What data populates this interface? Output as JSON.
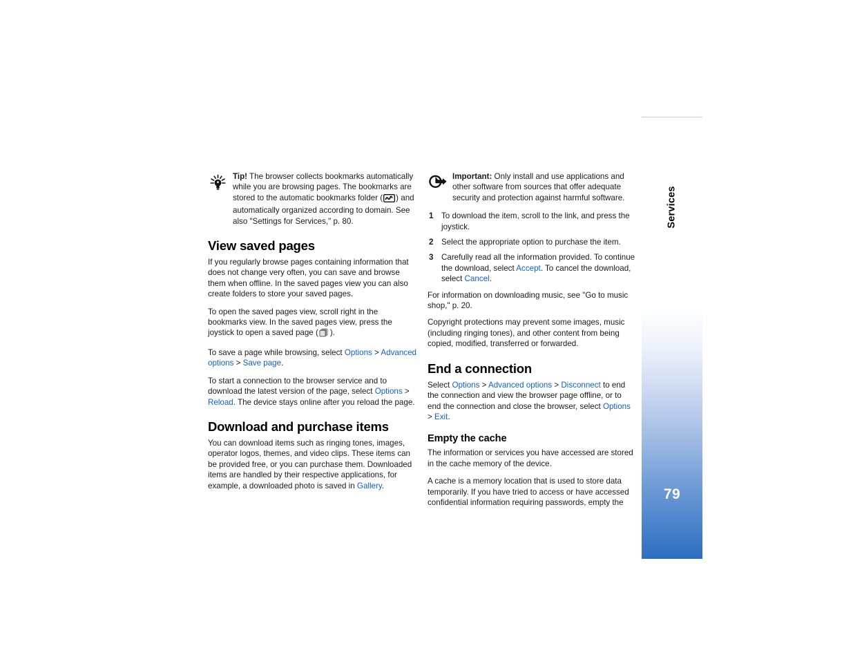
{
  "page": {
    "number": "79",
    "section_label": "Services"
  },
  "left_column": {
    "tip_note": {
      "icon": "lightbulb-icon",
      "lead": "Tip!",
      "text_before_icon": " The browser collects bookmarks automatically while you are browsing pages. The bookmarks are stored to the automatic bookmarks folder (",
      "inline_icon": "bookmarks-folder-icon",
      "text_after_icon": ") and automatically organized according to domain. See also \"Settings for Services,\" p. 80."
    },
    "heading_view_saved_pages": "View saved pages",
    "para_1": "If you regularly browse pages containing information that does not change very often, you can save and browse them when offline. In the saved pages view you can also create folders to store your saved pages.",
    "para_2_before_icon": "To open the saved pages view, scroll right in the bookmarks view. In the saved pages view, press the joystick to open a saved page (",
    "para_2_inline_icon": "saved-page-icon",
    "para_2_after_icon": ").",
    "para_3": {
      "t1": "To save a page while browsing, select ",
      "l1": "Options",
      "s1": " > ",
      "l2": "Advanced options",
      "s2": " > ",
      "l3": "Save page",
      "t2": "."
    },
    "para_4": {
      "t1": "To start a connection to the browser service and to download the latest version of the page, select ",
      "l1": "Options",
      "s1": " > ",
      "l2": "Reload",
      "t2": ". The device stays online after you reload the page."
    },
    "heading_download_purchase": "Download and purchase items",
    "para_5": {
      "t1": "You can download items such as ringing tones, images, operator logos, themes, and video clips. These items can be provided free, or you can purchase them. Downloaded items are handled by their respective applications, for example, a downloaded photo is saved in ",
      "l1": "Gallery",
      "t2": "."
    }
  },
  "right_column": {
    "important_note": {
      "icon": "important-arrow-icon",
      "lead": "Important:",
      "text": " Only install and use applications and other software from sources that offer adequate security and protection against harmful software."
    },
    "steps": [
      {
        "num": "1",
        "text": "To download the item, scroll to the link, and press the joystick."
      },
      {
        "num": "2",
        "text": "Select the appropriate option to purchase the item."
      },
      {
        "num": "3",
        "t1": "Carefully read all the information provided. To continue the download, select ",
        "l1": "Accept",
        "t2": ". To cancel the download, select ",
        "l2": "Cancel",
        "t3": "."
      }
    ],
    "para_music": "For information on downloading music, see \"Go to music shop,\" p. 20.",
    "para_copyright": "Copyright protections may prevent some images, music (including ringing tones), and other content from being copied, modified, transferred or forwarded.",
    "heading_end_connection": "End a connection",
    "para_end": {
      "t1": "Select ",
      "l1": "Options",
      "s1": " > ",
      "l2": "Advanced options",
      "s2": " > ",
      "l3": "Disconnect",
      "t2": " to end the connection and view the browser page offline, or to end the connection and close the browser, select ",
      "l4": "Options",
      "s3": " > ",
      "l5": "Exit",
      "t3": "."
    },
    "heading_empty_cache": "Empty the cache",
    "para_cache_1": "The information or services you have accessed are stored in the cache memory of the device.",
    "para_cache_2": "A cache is a memory location that is used to store data temporarily. If you have tried to access or have accessed confidential information requiring passwords, empty the"
  },
  "colors": {
    "link": "#0f5fd0",
    "sidebar_bottom": "#2d6ebf",
    "sidebar_topline": "#b9cde8",
    "text": "#1a1a1a"
  }
}
